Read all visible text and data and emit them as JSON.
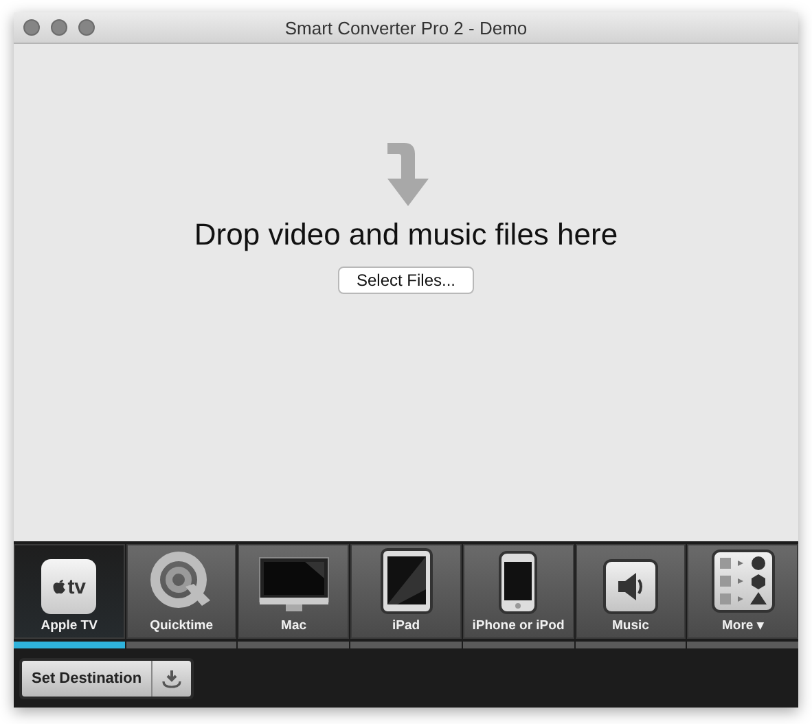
{
  "window": {
    "title": "Smart Converter Pro 2 - Demo"
  },
  "drop_area": {
    "message": "Drop video and music files here",
    "button": "Select Files..."
  },
  "presets": [
    {
      "kind": "appletv",
      "label": "Apple TV",
      "icon_text": "tv",
      "selected": true
    },
    {
      "kind": "quicktime",
      "label": "Quicktime",
      "selected": false
    },
    {
      "kind": "mac",
      "label": "Mac",
      "selected": false
    },
    {
      "kind": "ipad",
      "label": "iPad",
      "selected": false
    },
    {
      "kind": "iphone",
      "label": "iPhone or iPod",
      "selected": false
    },
    {
      "kind": "music",
      "label": "Music",
      "selected": false
    },
    {
      "kind": "more",
      "label": "More ▾",
      "selected": false
    }
  ],
  "bottom_bar": {
    "destination_button": "Set Destination"
  }
}
